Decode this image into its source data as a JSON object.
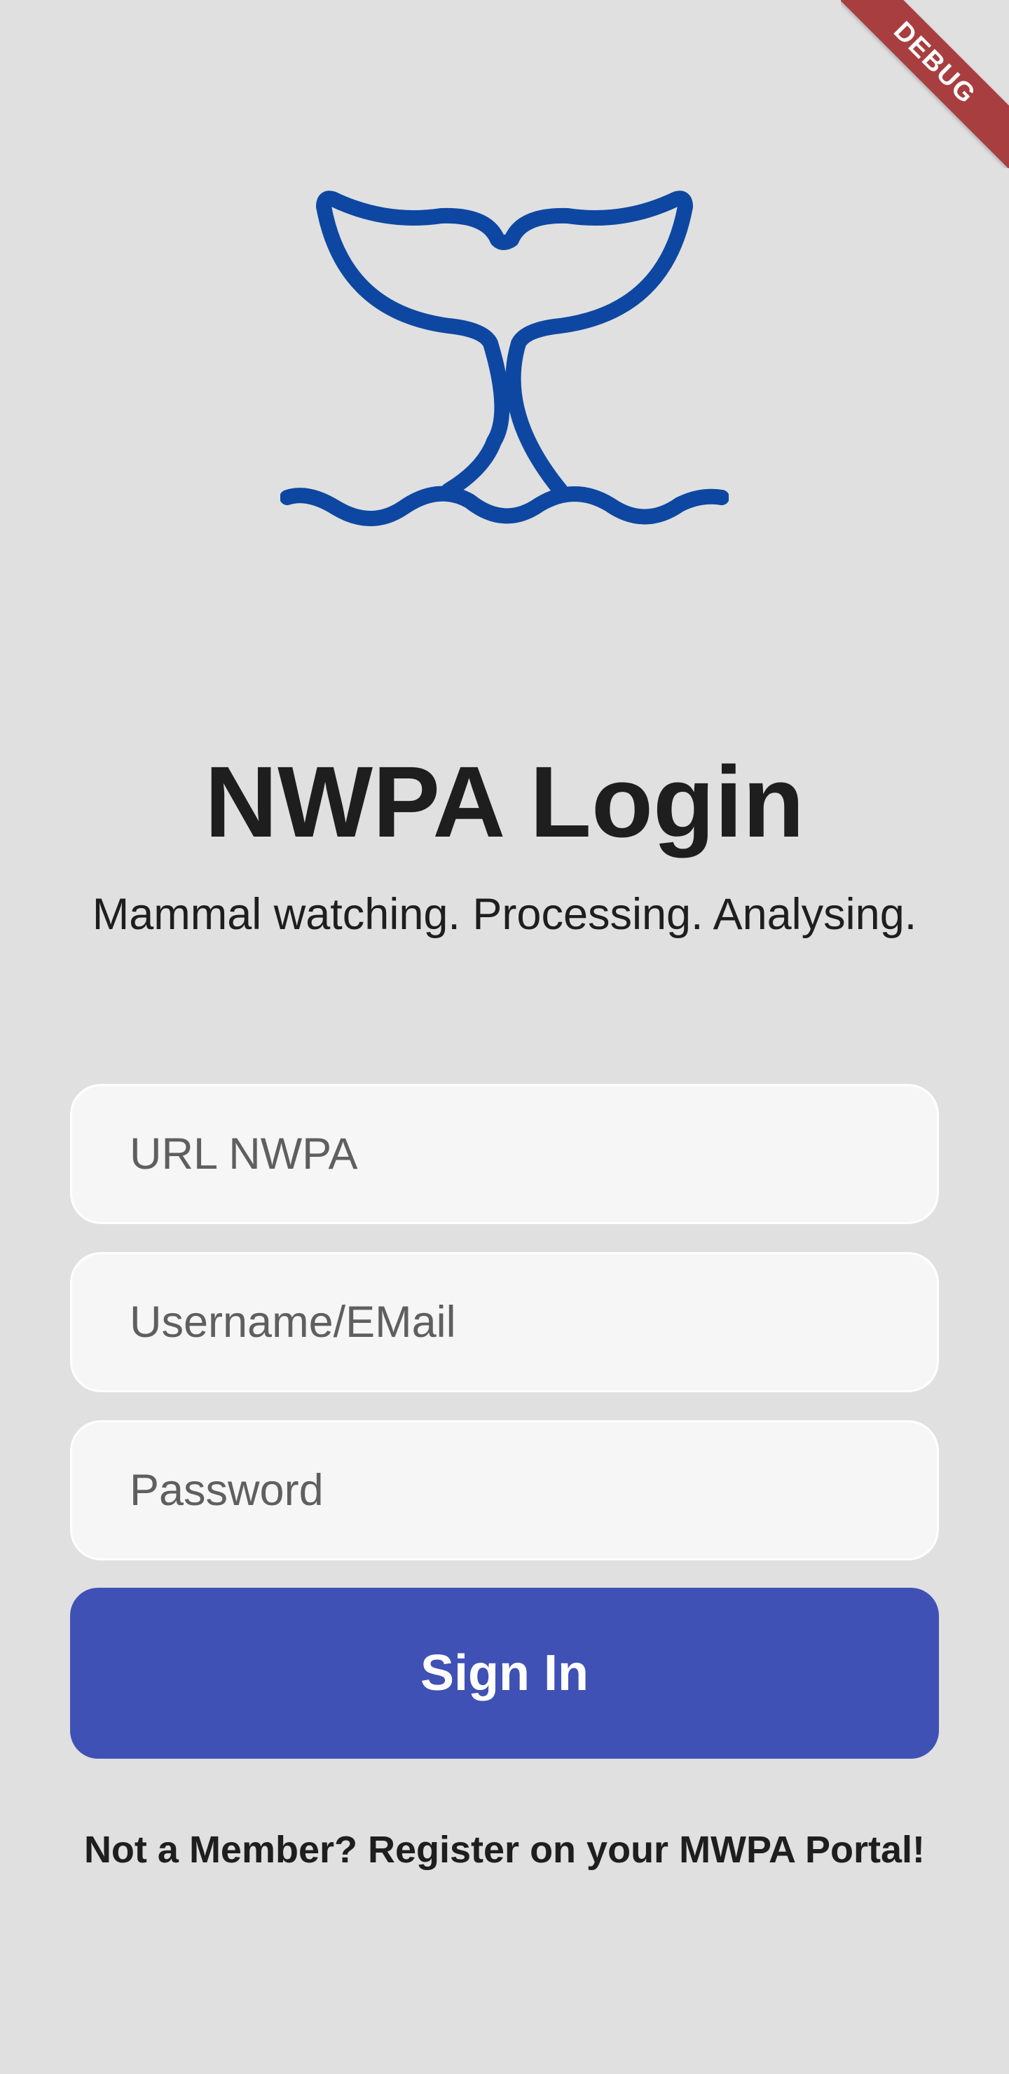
{
  "app": {
    "icon": "whale-tail-icon",
    "title": "NWPA Login",
    "subtitle": "Mammal watching. Processing. Analysing."
  },
  "form": {
    "url_placeholder": "URL NWPA",
    "username_placeholder": "Username/EMail",
    "password_placeholder": "Password",
    "signin_label": "Sign In"
  },
  "footer": {
    "register_text": "Not a Member? Register on your MWPA Portal!"
  },
  "debug_banner": {
    "label": "DEBUG"
  },
  "colors": {
    "background": "#e0e0e1",
    "accent": "#3f51b5",
    "logo": "#0d47a1",
    "debug": "#a83e40"
  }
}
